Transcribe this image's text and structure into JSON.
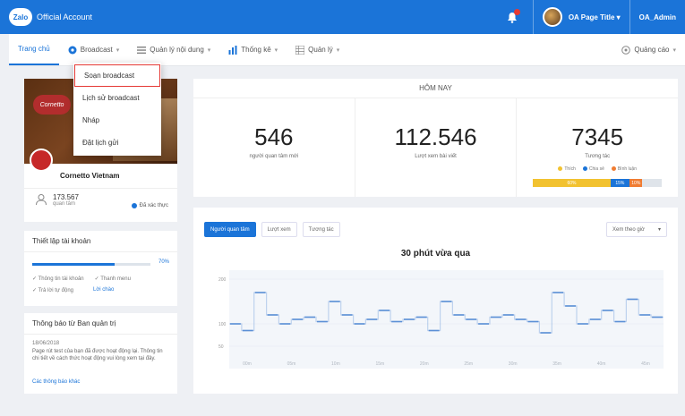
{
  "app": {
    "logo": "Zalo",
    "title": "Official Account"
  },
  "topbar": {
    "page_title": "OA Page Title",
    "admin": "OA_Admin",
    "notification_icon": "bell-icon"
  },
  "nav": {
    "home": "Trang chủ",
    "broadcast": "Broadcast",
    "content": "Quản lý nội dung",
    "stats": "Thống kê",
    "manage": "Quản lý",
    "ads": "Quảng cáo"
  },
  "dropdown": {
    "items": [
      "Soạn broadcast",
      "Lịch sử broadcast",
      "Nháp",
      "Đặt lịch gửi"
    ]
  },
  "profile": {
    "name": "Cornetto Vietnam",
    "cover_logo": "Cornetto",
    "followers": "173.567",
    "followers_label": "quan tâm",
    "verified": "Đã xác thực"
  },
  "setup": {
    "title": "Thiết lập tài khoản",
    "percent_label": "70%",
    "progress": 0.7,
    "items": [
      "Thông tin tài khoản",
      "Thanh menu",
      "Trả lời tự động",
      "Lời chào"
    ]
  },
  "notice": {
    "title": "Thông báo từ Ban quản trị",
    "date": "18/06/2018",
    "text": "Page rút test của bạn đã được hoạt động lại. Thông tin chi tiết về cách thức hoạt động vui lòng xem tại đây.",
    "link": "Các thông báo khác"
  },
  "today": {
    "title": "HÔM NAY",
    "stats": [
      {
        "value": "546",
        "label": "người quan tâm mới"
      },
      {
        "value": "112.546",
        "label": "Lượt xem bài viết"
      },
      {
        "value": "7345",
        "label": "Tương tác"
      }
    ],
    "legend": [
      "Thích",
      "Chia sẻ",
      "Bình luận"
    ],
    "segments": [
      {
        "label": "60%",
        "fraction": 0.6,
        "color": "#f2c230"
      },
      {
        "label": "15%",
        "fraction": 0.15,
        "color": "#1b74d8"
      },
      {
        "label": "10%",
        "fraction": 0.1,
        "color": "#f07c32"
      }
    ]
  },
  "chart_panel": {
    "tabs": [
      "Người quan tâm",
      "Lượt xem",
      "Tương tác"
    ],
    "filter": "Xem theo giờ"
  },
  "chart_data": {
    "type": "line",
    "title": "30 phút vừa qua",
    "y_ticks": [
      "200",
      "100",
      "50"
    ],
    "x_ticks": [
      "00m",
      "05m",
      "10m",
      "15m",
      "20m",
      "25m",
      "30m",
      "35m",
      "40m",
      "45m"
    ],
    "ylim": [
      0,
      220
    ],
    "series": [
      {
        "name": "",
        "color": "#5b8fd6",
        "values": [
          100,
          85,
          170,
          120,
          100,
          110,
          115,
          105,
          150,
          120,
          100,
          110,
          130,
          105,
          110,
          115,
          85,
          150,
          120,
          110,
          100,
          115,
          120,
          110,
          105,
          80,
          170,
          140,
          100,
          110,
          130,
          105,
          155,
          120,
          115
        ]
      }
    ]
  }
}
